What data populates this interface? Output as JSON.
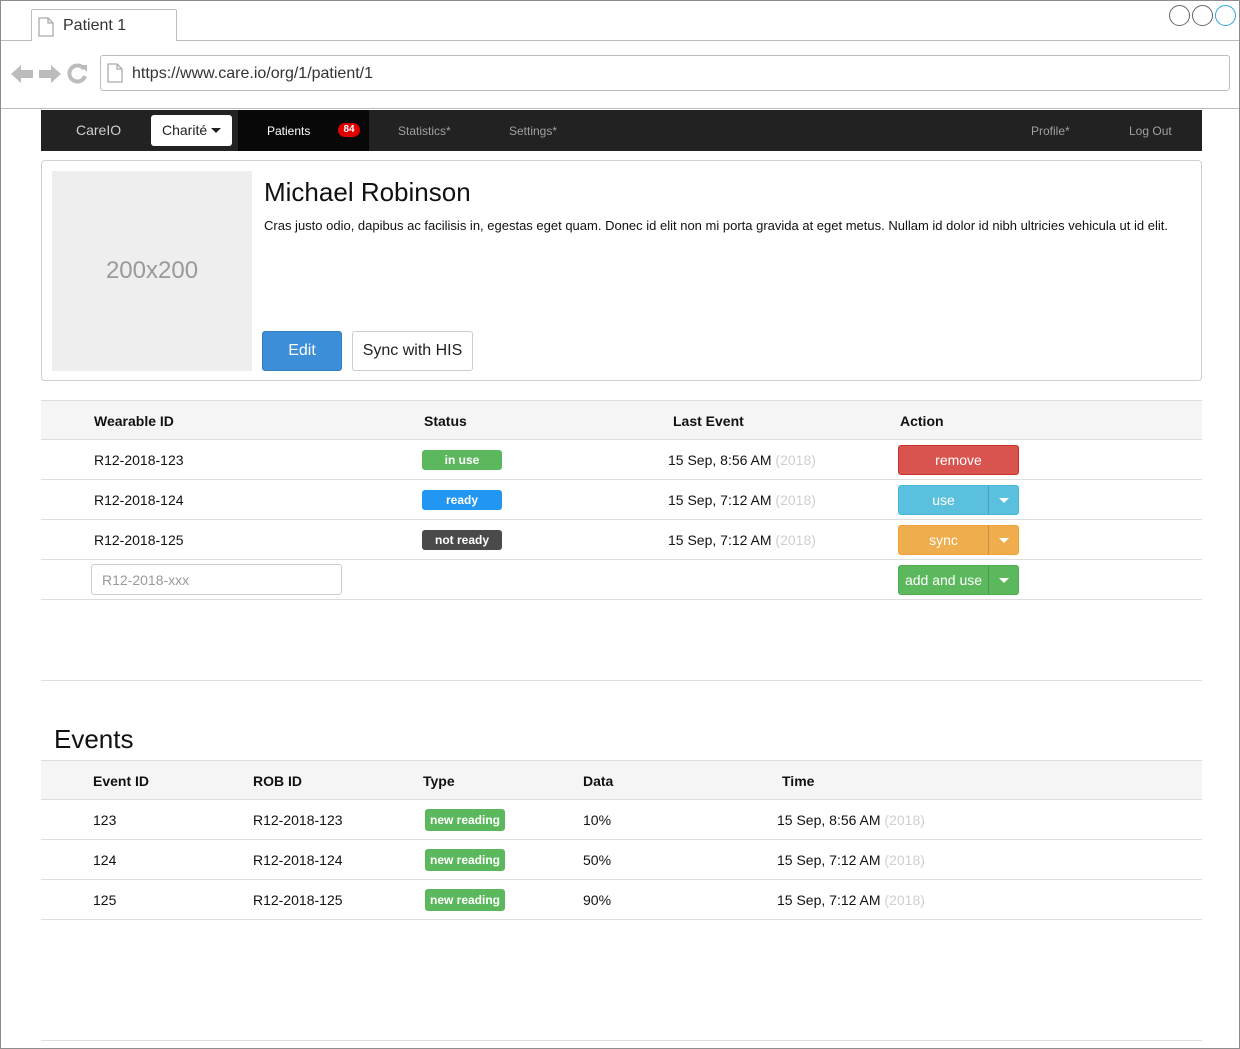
{
  "browser": {
    "tab_title": "Patient 1",
    "url": "https://www.care.io/org/1/patient/1"
  },
  "navbar": {
    "brand": "CareIO",
    "org": "Charité",
    "patients_label": "Patients",
    "patients_badge": "84",
    "statistics": "Statistics*",
    "settings": "Settings*",
    "profile": "Profile*",
    "logout": "Log Out"
  },
  "patient": {
    "photo_placeholder": "200x200",
    "name": "Michael Robinson",
    "description": "Cras justo odio, dapibus ac facilisis in, egestas eget quam. Donec id elit non mi porta gravida at eget metus. Nullam id dolor id nibh ultricies vehicula ut id elit.",
    "edit_label": "Edit",
    "sync_label": "Sync with HIS"
  },
  "wearables": {
    "headers": {
      "id": "Wearable ID",
      "status": "Status",
      "last_event": "Last Event",
      "action": "Action"
    },
    "rows": [
      {
        "id": "R12-2018-123",
        "status": "in use",
        "last_event": "15 Sep, 8:56 AM",
        "year": "(2018)",
        "action": "remove"
      },
      {
        "id": "R12-2018-124",
        "status": "ready",
        "last_event": "15 Sep, 7:12 AM",
        "year": "(2018)",
        "action": "use"
      },
      {
        "id": "R12-2018-125",
        "status": "not ready",
        "last_event": "15 Sep, 7:12 AM",
        "year": "(2018)",
        "action": "sync"
      }
    ],
    "new_placeholder": "R12-2018-xxx",
    "add_label": "add and use"
  },
  "events": {
    "title": "Events",
    "headers": {
      "event_id": "Event ID",
      "rob_id": "ROB ID",
      "type": "Type",
      "data": "Data",
      "time": "Time"
    },
    "rows": [
      {
        "event_id": "123",
        "rob_id": "R12-2018-123",
        "type": "new reading",
        "data": "10%",
        "time": "15 Sep, 8:56 AM",
        "year": "(2018)"
      },
      {
        "event_id": "124",
        "rob_id": "R12-2018-124",
        "type": "new reading",
        "data": "50%",
        "time": "15 Sep, 7:12 AM",
        "year": "(2018)"
      },
      {
        "event_id": "125",
        "rob_id": "R12-2018-125",
        "type": "new reading",
        "data": "90%",
        "time": "15 Sep, 7:12 AM",
        "year": "(2018)"
      }
    ]
  },
  "colors": {
    "navbar_bg": "#222222",
    "primary": "#3d8ed8",
    "danger": "#d9534f",
    "info": "#5bc0de",
    "warning": "#f0ad4e",
    "success": "#5cb85c",
    "status_blue": "#2196f3",
    "status_dark": "#4a4a4a",
    "badge_red": "#e00000"
  },
  "icons": [
    "page-icon",
    "back-arrow-icon",
    "forward-arrow-icon",
    "reload-icon",
    "caret-down-icon",
    "window-control-icon"
  ]
}
